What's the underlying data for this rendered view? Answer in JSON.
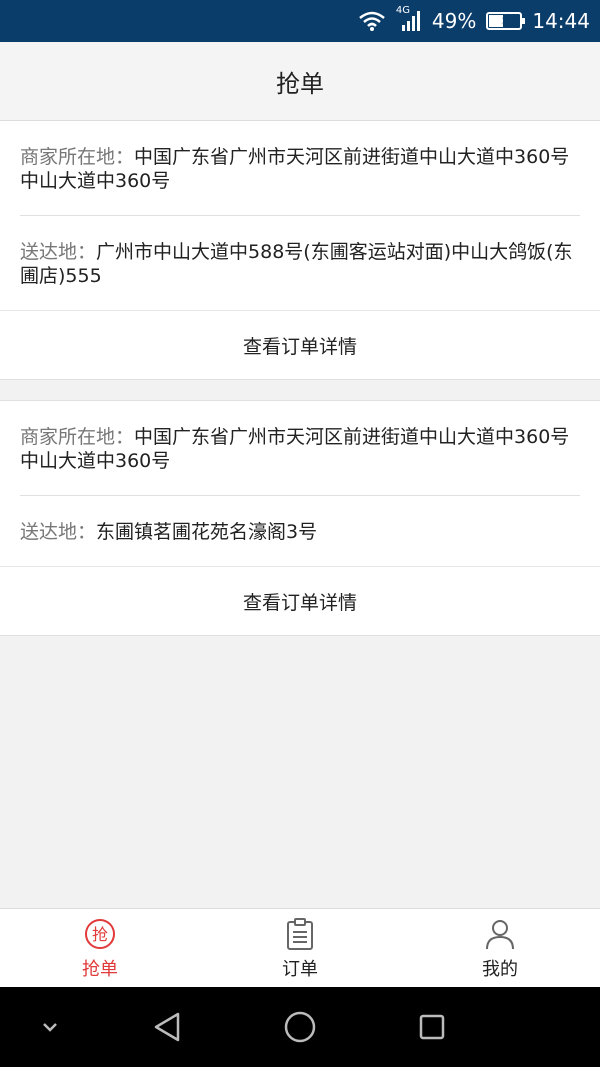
{
  "status_bar": {
    "network": "4G",
    "battery": "49%",
    "time": "14:44",
    "battery_level": 0.49
  },
  "header": {
    "title": "抢单"
  },
  "orders": [
    {
      "merchant_label": "商家所在地：",
      "merchant_address": "中国广东省广州市天河区前进街道中山大道中360号 中山大道中360号",
      "delivery_label": "送达地：",
      "delivery_address": "广州市中山大道中588号(东圃客运站对面)中山大鸽饭(东圃店)555",
      "detail_button": "查看订单详情"
    },
    {
      "merchant_label": "商家所在地：",
      "merchant_address": "中国广东省广州市天河区前进街道中山大道中360号 中山大道中360号",
      "delivery_label": "送达地：",
      "delivery_address": "东圃镇茗圃花苑名濠阁3号",
      "detail_button": "查看订单详情"
    }
  ],
  "tab_bar": {
    "tabs": [
      {
        "label": "抢单",
        "icon": "grab-order-icon",
        "active": true
      },
      {
        "label": "订单",
        "icon": "clipboard-icon",
        "active": false
      },
      {
        "label": "我的",
        "icon": "user-icon",
        "active": false
      }
    ],
    "active_color": "#e03a3a"
  },
  "nav_bar": {
    "buttons": [
      "chevron-down-icon",
      "back-icon",
      "home-icon",
      "recents-icon"
    ]
  }
}
